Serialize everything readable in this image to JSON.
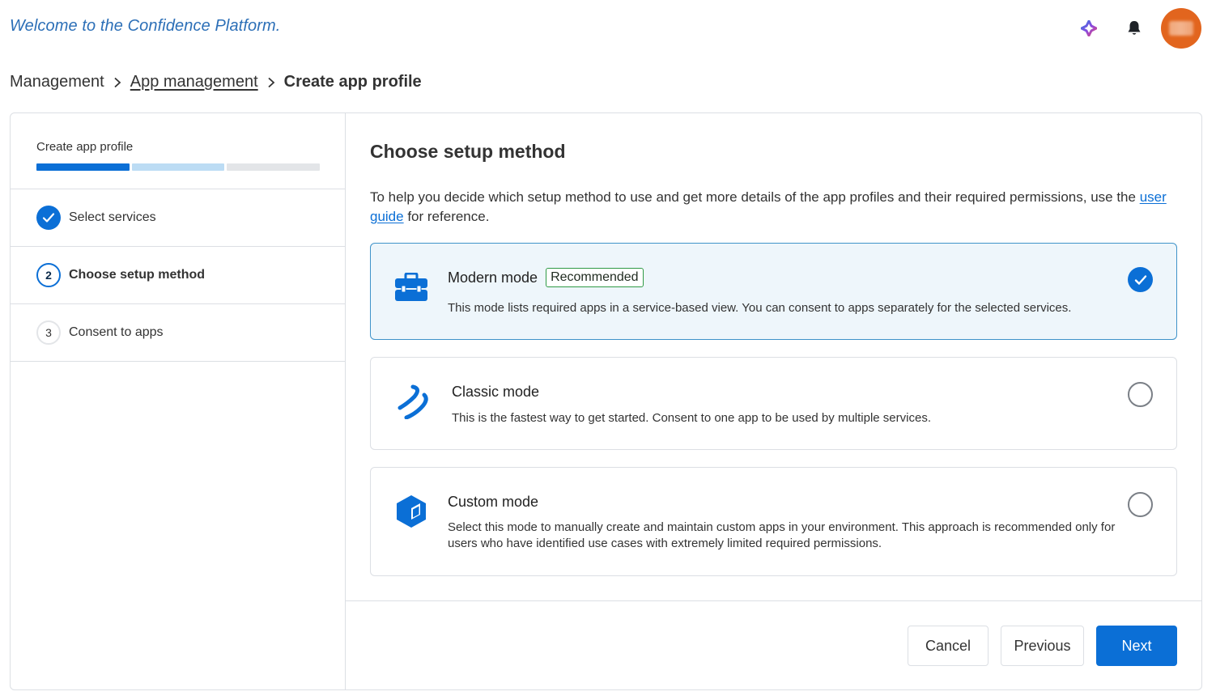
{
  "header": {
    "welcome": "Welcome to the Confidence Platform.",
    "icons": [
      "sparkle-icon",
      "bell-icon"
    ]
  },
  "breadcrumb": {
    "items": [
      "Management",
      "App management",
      "Create app profile"
    ]
  },
  "wizard": {
    "title": "Create app profile",
    "progress_segments": 3,
    "completed_segments": 1,
    "steps": [
      {
        "number": "",
        "label": "Select services",
        "status": "done"
      },
      {
        "number": "2",
        "label": "Choose setup method",
        "status": "active"
      },
      {
        "number": "3",
        "label": "Consent to apps",
        "status": "pending"
      }
    ]
  },
  "main": {
    "title": "Choose setup method",
    "intro_before": "To help you decide which setup method to use and get more details of the app profiles and their required permissions, use the ",
    "intro_link": "user guide",
    "intro_after": " for reference.",
    "options": [
      {
        "title": "Modern mode",
        "badge": "Recommended",
        "desc": "This mode lists required apps in a service-based view. You can consent to apps separately for the selected services.",
        "selected": true,
        "icon": "toolbox-icon"
      },
      {
        "title": "Classic mode",
        "badge": "",
        "desc": "This is the fastest way to get started. Consent to one app to be used by multiple services.",
        "selected": false,
        "icon": "double-wave-icon"
      },
      {
        "title": "Custom mode",
        "badge": "",
        "desc": "Select this mode to manually create and maintain custom apps in your environment. This approach is recommended only for users who have identified use cases with extremely limited required permissions.",
        "selected": false,
        "icon": "cube-icon"
      }
    ]
  },
  "footer": {
    "cancel": "Cancel",
    "previous": "Previous",
    "next": "Next"
  },
  "colors": {
    "accent": "#0b6fd6",
    "progress_done": "#0b6fd6",
    "progress_next": "#bcdcf4",
    "progress_rest": "#e3e5e8",
    "badge_green": "#2f9a45",
    "avatar": "#e2651e"
  }
}
